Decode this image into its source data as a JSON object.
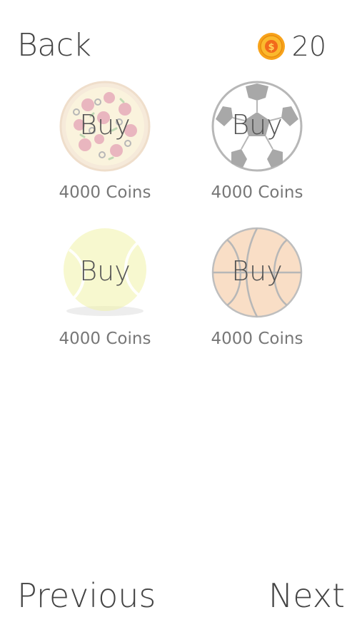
{
  "header": {
    "back_label": "Back",
    "coins": "20",
    "coin_icon": "coin-icon",
    "coin_color": "#f7a81a"
  },
  "items": [
    {
      "name": "pizza",
      "icon": "pizza-icon",
      "buy_label": "Buy",
      "price": "4000 Coins"
    },
    {
      "name": "soccer ball",
      "icon": "soccer-ball-icon",
      "buy_label": "Buy",
      "price": "4000 Coins"
    },
    {
      "name": "tennis ball",
      "icon": "tennis-ball-icon",
      "buy_label": "Buy",
      "price": "4000 Coins"
    },
    {
      "name": "basketball",
      "icon": "basketball-icon",
      "buy_label": "Buy",
      "price": "4000 Coins"
    }
  ],
  "footer": {
    "previous_label": "Previous",
    "next_label": "Next"
  }
}
